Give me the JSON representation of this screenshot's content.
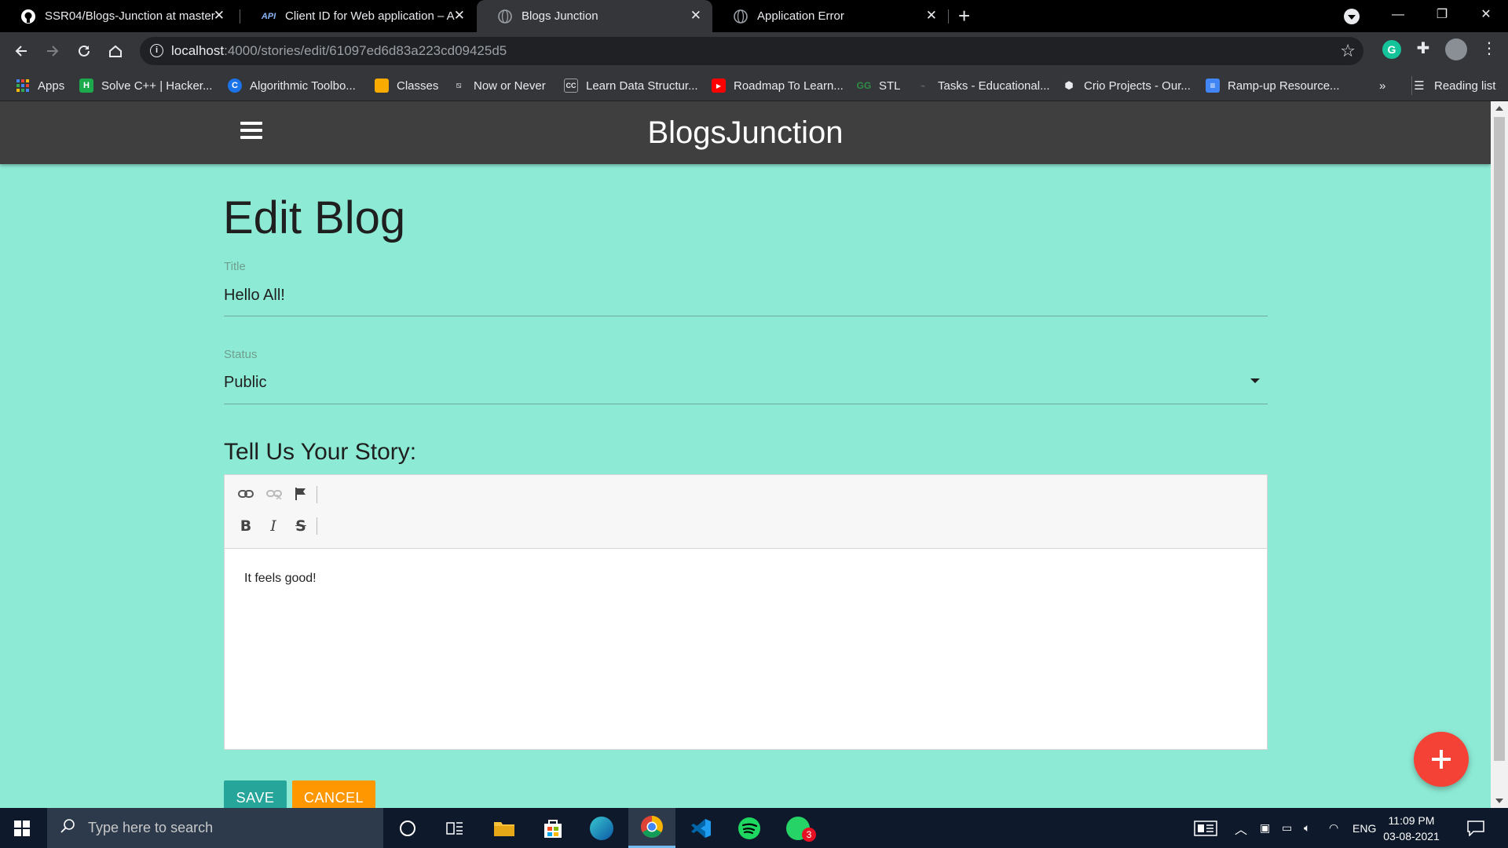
{
  "browser": {
    "tabs": [
      {
        "title": "SSR04/Blogs-Junction at master",
        "icon": "github-icon",
        "active": false
      },
      {
        "title": "Client ID for Web application – A",
        "icon": "api-icon",
        "active": false
      },
      {
        "title": "Blogs Junction",
        "icon": "globe-icon",
        "active": true
      },
      {
        "title": "Application Error",
        "icon": "globe-icon",
        "active": false
      }
    ],
    "url_host": "localhost",
    "url_rest": ":4000/stories/edit/61097ed6d83a223cd09425d5",
    "bookmarks": [
      {
        "label": "Apps",
        "icon": "apps-grid-icon",
        "color": "#4285f4"
      },
      {
        "label": "Solve C++ | Hacker...",
        "icon": "hackerrank-icon",
        "color": "#1ba94c"
      },
      {
        "label": "Algorithmic Toolbo...",
        "icon": "coursera-icon",
        "color": "#1a73e8"
      },
      {
        "label": "Classes",
        "icon": "classroom-icon",
        "color": "#f9ab00"
      },
      {
        "label": "Now or Never",
        "icon": "bookmark-icon",
        "color": "#9aa0a6"
      },
      {
        "label": "Learn Data Structur...",
        "icon": "codechef-icon",
        "color": "#9aa0a6"
      },
      {
        "label": "Roadmap To Learn...",
        "icon": "youtube-icon",
        "color": "#ff0000"
      },
      {
        "label": "STL",
        "icon": "gfg-icon",
        "color": "#2f8d46"
      },
      {
        "label": "Tasks - Educational...",
        "icon": "link-icon",
        "color": "#9aa0a6"
      },
      {
        "label": "Crio Projects - Our...",
        "icon": "crio-icon",
        "color": "#e8eaed"
      },
      {
        "label": "Ramp-up Resource...",
        "icon": "docs-icon",
        "color": "#4285f4"
      }
    ],
    "more_bookmarks": "»",
    "reading_list": "Reading list"
  },
  "app": {
    "brand": "BlogsJunction",
    "page_title": "Edit Blog",
    "title_label": "Title",
    "title_value": "Hello All!",
    "status_label": "Status",
    "status_value": "Public",
    "story_heading": "Tell Us Your Story:",
    "story_body": "It feels good!",
    "save_label": "SAVE",
    "cancel_label": "CANCEL",
    "colors": {
      "page_bg": "#8debd5",
      "appbar": "#3f3f3f",
      "save": "#26a69a",
      "cancel": "#ff9800",
      "fab": "#f44336"
    }
  },
  "taskbar": {
    "search_placeholder": "Type here to search",
    "language": "ENG",
    "time": "11:09 PM",
    "date": "03-08-2021",
    "whatsapp_badge": "3"
  }
}
